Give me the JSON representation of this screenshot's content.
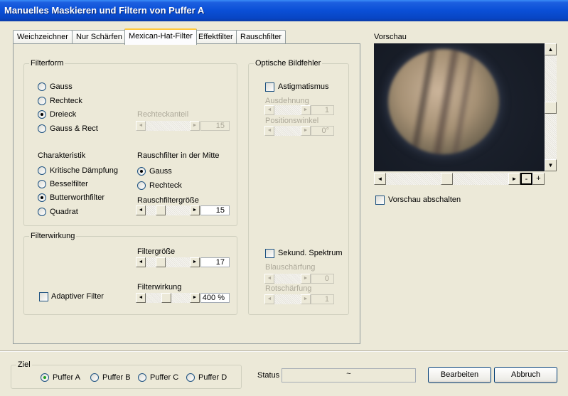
{
  "window": {
    "title": "Manuelles Maskieren und Filtern von Puffer A"
  },
  "tabs": [
    {
      "label": "Weichzeichner"
    },
    {
      "label": "Nur Schärfen"
    },
    {
      "label": "Mexican-Hat-Filter",
      "active": true
    },
    {
      "label": "Effektfilter"
    },
    {
      "label": "Rauschfilter"
    }
  ],
  "filterform": {
    "title": "Filterform",
    "options": [
      "Gauss",
      "Rechteck",
      "Dreieck",
      "Gauss & Rect"
    ],
    "selected": "Dreieck",
    "rechteckanteil": {
      "label": "Rechteckanteil",
      "value": "15",
      "level": 1.0
    },
    "charakteristik": {
      "title": "Charakteristik",
      "options": [
        "Kritische Dämpfung",
        "Besselfilter",
        "Butterworthfilter",
        "Quadrat"
      ],
      "selected": "Butterworthfilter"
    },
    "rauschfilter_mitte": {
      "title": "Rauschfilter in der Mitte",
      "options": [
        "Gauss",
        "Rechteck"
      ],
      "selected": "Gauss"
    },
    "rauschfiltergroesse": {
      "label": "Rauschfiltergröße",
      "value": "15",
      "level": 0.2
    }
  },
  "filterwirkung": {
    "title": "Filterwirkung",
    "filtergroesse": {
      "label": "Filtergröße",
      "value": "17",
      "level": 0.2
    },
    "adaptiver_filter": {
      "label": "Adaptiver Filter",
      "checked": false
    },
    "filterwirkung": {
      "label": "Filterwirkung",
      "value": "400 %",
      "level": 0.4
    }
  },
  "optische_bildfehler": {
    "title": "Optische Bildfehler",
    "astigmatismus": {
      "label": "Astigmatismus",
      "checked": false
    },
    "ausdehnung": {
      "label": "Ausdehnung",
      "value": "1"
    },
    "positionswinkel": {
      "label": "Positionswinkel",
      "value": "0°"
    },
    "sekund_spektrum": {
      "label": "Sekund. Spektrum",
      "checked": false
    },
    "blauschaerfung": {
      "label": "Blauschärfung",
      "value": "0"
    },
    "rotschaerfung": {
      "label": "Rotschärfung",
      "value": "1"
    }
  },
  "preview": {
    "title": "Vorschau",
    "disable_label": "Vorschau abschalten",
    "disabled": false,
    "zoom_out": "-",
    "zoom_in": "+"
  },
  "ziel": {
    "title": "Ziel",
    "options": [
      "Puffer A",
      "Puffer B",
      "Puffer C",
      "Puffer D"
    ],
    "selected": "Puffer A"
  },
  "status": {
    "label": "Status",
    "value": "~"
  },
  "buttons": {
    "edit": "Bearbeiten",
    "cancel": "Abbruch"
  },
  "icons": {
    "arrow_left": "◄",
    "arrow_right": "►",
    "arrow_up": "▲",
    "arrow_down": "▼"
  },
  "colors": {
    "title_bar": "#0a4fd6",
    "dialog_bg": "#ece9d8",
    "radio_selected": "#21a121"
  }
}
